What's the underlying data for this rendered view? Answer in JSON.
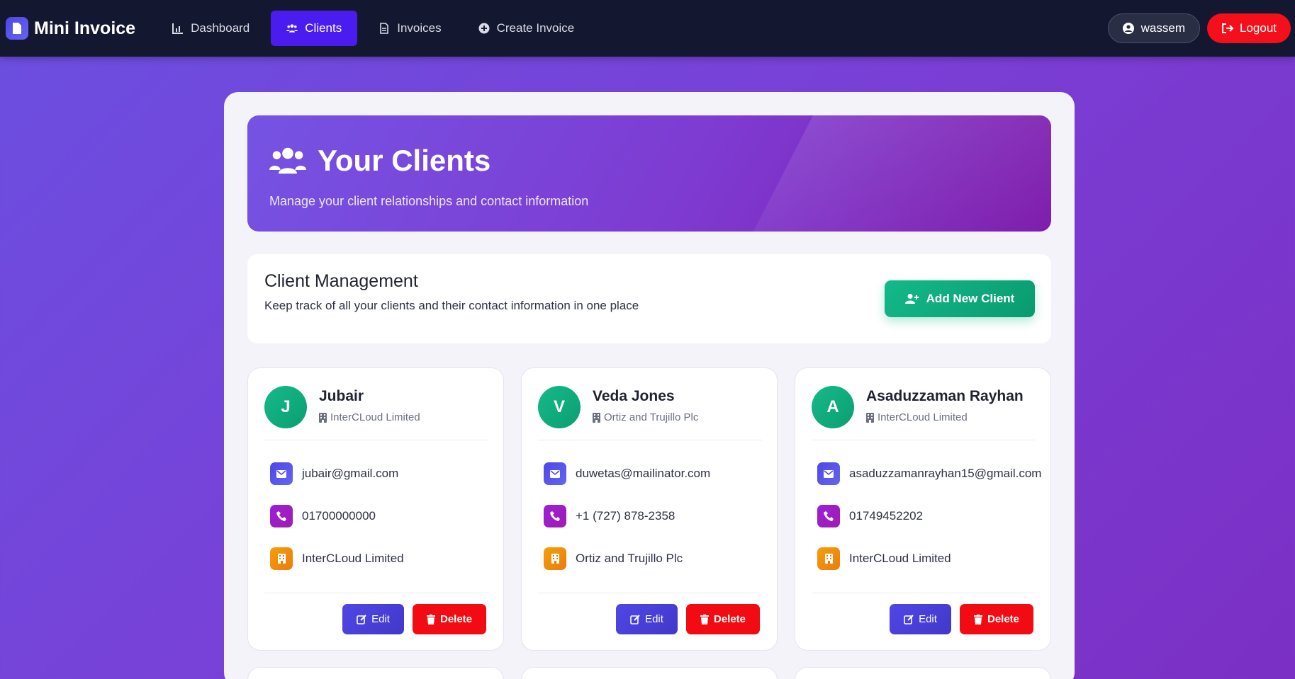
{
  "nav": {
    "brand": "Mini Invoice",
    "links": [
      {
        "label": "Dashboard",
        "icon": "chart-icon"
      },
      {
        "label": "Clients",
        "icon": "users-icon"
      },
      {
        "label": "Invoices",
        "icon": "document-icon"
      },
      {
        "label": "Create Invoice",
        "icon": "plus-circle-icon"
      }
    ],
    "active": "Clients",
    "user": "wassem",
    "logout": "Logout"
  },
  "hero": {
    "title": "Your Clients",
    "subtitle": "Manage your client relationships and contact information"
  },
  "management": {
    "title": "Client Management",
    "subtitle": "Keep track of all your clients and their contact information in one place",
    "add_button": "Add New Client"
  },
  "clients": [
    {
      "initial": "J",
      "name": "Jubair",
      "company": "InterCLoud Limited",
      "email": "jubair@gmail.com",
      "phone": "01700000000"
    },
    {
      "initial": "V",
      "name": "Veda Jones",
      "company": "Ortiz and Trujillo Plc",
      "email": "duwetas@mailinator.com",
      "phone": "+1 (727) 878-2358"
    },
    {
      "initial": "A",
      "name": "Asaduzzaman Rayhan",
      "company": "InterCLoud Limited",
      "email": "asaduzzamanrayhan15@gmail.com",
      "phone": "01749452202"
    }
  ],
  "card_actions": {
    "edit": "Edit",
    "delete": "Delete"
  },
  "colors": {
    "navbar": "#141730",
    "active_nav": "#4a1cf0",
    "logout": "#f50f1a",
    "add_button": "#10b981",
    "edit": "#4f46e5",
    "delete": "#f20b12"
  }
}
